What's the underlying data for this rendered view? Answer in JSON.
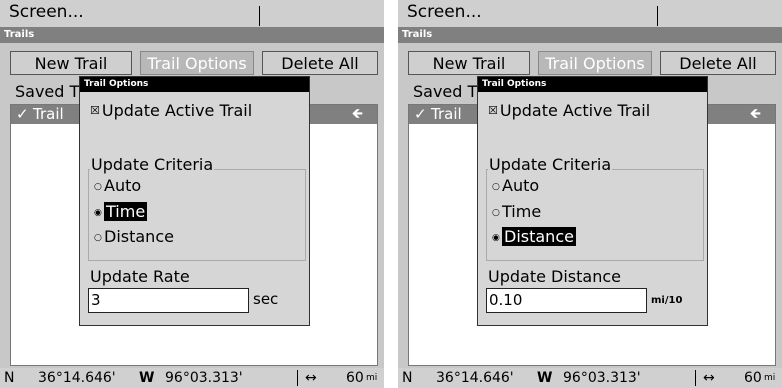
{
  "left": {
    "menu": "Screen...",
    "title": "Trails",
    "buttons": {
      "new_trail": "New Trail",
      "trail_options": "Trail Options",
      "delete_all": "Delete All"
    },
    "saved_label": "Saved T",
    "trail_row": {
      "check": "✓",
      "label": "Trail",
      "arrow": "🡸"
    },
    "status": {
      "lat_dir": "N",
      "lat": "36°14.646'",
      "lon_dir": "W",
      "lon": "96°03.313'",
      "arrow": "↔",
      "scale": "60",
      "unit": "mi"
    },
    "dialog": {
      "title": "Trail Options",
      "checkbox_mark": "☒",
      "checkbox_label": "Update Active Trail",
      "criteria_label": "Update Criteria",
      "options": [
        "Auto",
        "Time",
        "Distance"
      ],
      "selected": "Time",
      "rate_label": "Update Rate",
      "rate_value": "3",
      "rate_unit": "sec"
    }
  },
  "right": {
    "menu": "Screen...",
    "title": "Trails",
    "buttons": {
      "new_trail": "New Trail",
      "trail_options": "Trail Options",
      "delete_all": "Delete All"
    },
    "saved_label": "Saved T",
    "trail_row": {
      "check": "✓",
      "label": "Trail",
      "arrow": "🡸"
    },
    "status": {
      "lat_dir": "N",
      "lat": "36°14.646'",
      "lon_dir": "W",
      "lon": "96°03.313'",
      "arrow": "↔",
      "scale": "60",
      "unit": "mi"
    },
    "dialog": {
      "title": "Trail Options",
      "checkbox_mark": "☒",
      "checkbox_label": "Update Active Trail",
      "criteria_label": "Update Criteria",
      "options": [
        "Auto",
        "Time",
        "Distance"
      ],
      "selected": "Distance",
      "rate_label": "Update Distance",
      "rate_value": "0.10",
      "rate_unit": "mi/10"
    }
  }
}
